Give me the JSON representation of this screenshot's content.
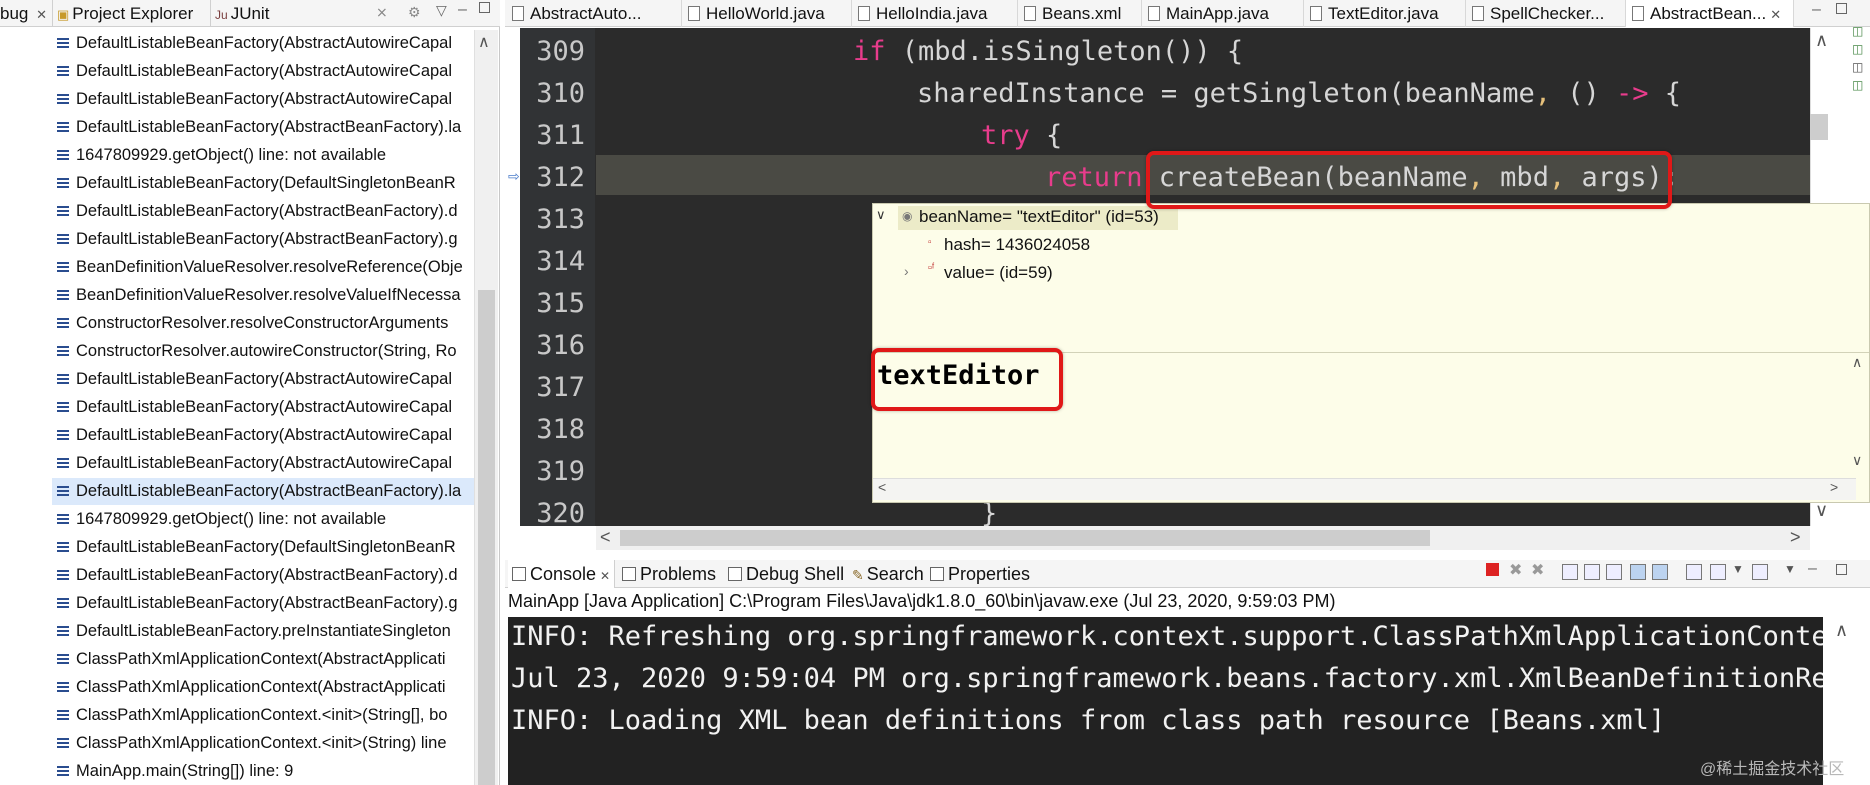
{
  "left_tabs": {
    "debug": "bug",
    "project_explorer": "Project Explorer",
    "junit": "JUnit",
    "junit_prefix": "Ju"
  },
  "stack_frames": [
    "DefaultListableBeanFactory(AbstractAutowireCapal",
    "DefaultListableBeanFactory(AbstractAutowireCapal",
    "DefaultListableBeanFactory(AbstractAutowireCapal",
    "DefaultListableBeanFactory(AbstractBeanFactory).la",
    "1647809929.getObject() line: not available",
    "DefaultListableBeanFactory(DefaultSingletonBeanR",
    "DefaultListableBeanFactory(AbstractBeanFactory).d",
    "DefaultListableBeanFactory(AbstractBeanFactory).g",
    "BeanDefinitionValueResolver.resolveReference(Obje",
    "BeanDefinitionValueResolver.resolveValueIfNecessa",
    "ConstructorResolver.resolveConstructorArguments",
    "ConstructorResolver.autowireConstructor(String, Ro",
    "DefaultListableBeanFactory(AbstractAutowireCapal",
    "DefaultListableBeanFactory(AbstractAutowireCapal",
    "DefaultListableBeanFactory(AbstractAutowireCapal",
    "DefaultListableBeanFactory(AbstractAutowireCapal",
    "DefaultListableBeanFactory(AbstractBeanFactory).la",
    "1647809929.getObject() line: not available",
    "DefaultListableBeanFactory(DefaultSingletonBeanR",
    "DefaultListableBeanFactory(AbstractBeanFactory).d",
    "DefaultListableBeanFactory(AbstractBeanFactory).g",
    "DefaultListableBeanFactory.preInstantiateSingleton",
    "ClassPathXmlApplicationContext(AbstractApplicati",
    "ClassPathXmlApplicationContext(AbstractApplicati",
    "ClassPathXmlApplicationContext.<init>(String[], bo",
    "ClassPathXmlApplicationContext.<init>(String) line",
    "MainApp.main(String[]) line: 9"
  ],
  "selected_frame_index": 16,
  "editor_tabs": [
    "AbstractAuto...",
    "HelloWorld.java",
    "HelloIndia.java",
    "Beans.xml",
    "MainApp.java",
    "TextEditor.java",
    "SpellChecker...",
    "AbstractBean..."
  ],
  "code_lines": {
    "309": "309",
    "310": "310",
    "311": "311",
    "312": "312",
    "313": "313",
    "314": "314",
    "315": "315",
    "316": "316",
    "317": "317",
    "318": "318",
    "319": "319",
    "320": "320"
  },
  "code": {
    "l309_kw": "if",
    "l309_rest": " (mbd.isSingleton()) {",
    "l310_a": "sharedInstance = getSingleton(beanName",
    "l310_comma": ",",
    "l310_b": " () ",
    "l310_arrow": "->",
    "l310_c": " {",
    "l311_kw": "try",
    "l311_rest": " {",
    "l312_kw": "return",
    "l312_a": " createBean(beanName",
    "l312_c1": ",",
    "l312_b": " mbd",
    "l312_c2": ",",
    "l312_d": " args);",
    "l320": "}"
  },
  "popup": {
    "root_label": "beanName= \"textEditor\" (id=53)",
    "hash_label": "hash= 1436024058",
    "value_label": "value= (id=59)",
    "detail_value": "textEditor"
  },
  "console_tabs": {
    "console": "Console",
    "problems": "Problems",
    "debug_shell": "Debug Shell",
    "search": "Search",
    "properties": "Properties"
  },
  "console": {
    "description": "MainApp [Java Application] C:\\Program Files\\Java\\jdk1.8.0_60\\bin\\javaw.exe (Jul 23, 2020, 9:59:03 PM)",
    "lines": [
      "INFO: Refreshing org.springframework.context.support.ClassPathXmlApplicationContex",
      "Jul 23, 2020 9:59:04 PM org.springframework.beans.factory.xml.XmlBeanDefinitionRea",
      "INFO: Loading XML bean definitions from class path resource [Beans.xml]"
    ]
  },
  "watermark": "@稀土掘金技术社区",
  "colors": {
    "editor_bg": "#2b2b2b",
    "keyword": "#e83c8c",
    "annotation_red": "#e01818",
    "popup_bg": "#fdfde9"
  }
}
